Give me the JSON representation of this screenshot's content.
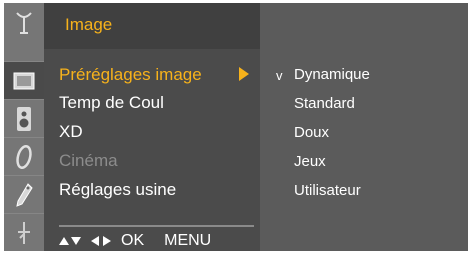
{
  "menu": {
    "title": "Image",
    "items": [
      {
        "label": "Préréglages image",
        "state": "selected"
      },
      {
        "label": "Temp de Coul",
        "state": "normal"
      },
      {
        "label": "XD",
        "state": "normal"
      },
      {
        "label": "Cinéma",
        "state": "disabled"
      },
      {
        "label": "Réglages usine",
        "state": "normal"
      }
    ]
  },
  "submenu": {
    "check_glyph": "v",
    "items": [
      "Dynamique",
      "Standard",
      "Doux",
      "Jeux",
      "Utilisateur"
    ],
    "checked_item": "Dynamique"
  },
  "footer": {
    "ok_label": "OK",
    "menu_label": "MENU"
  },
  "icons": [
    "antenna-icon",
    "picture-icon",
    "speaker-icon",
    "clock-icon",
    "key-icon",
    "network-icon"
  ],
  "colors": {
    "accent": "#f7b21b",
    "panel": "#4b4b4b",
    "background": "#5b5b5b"
  }
}
